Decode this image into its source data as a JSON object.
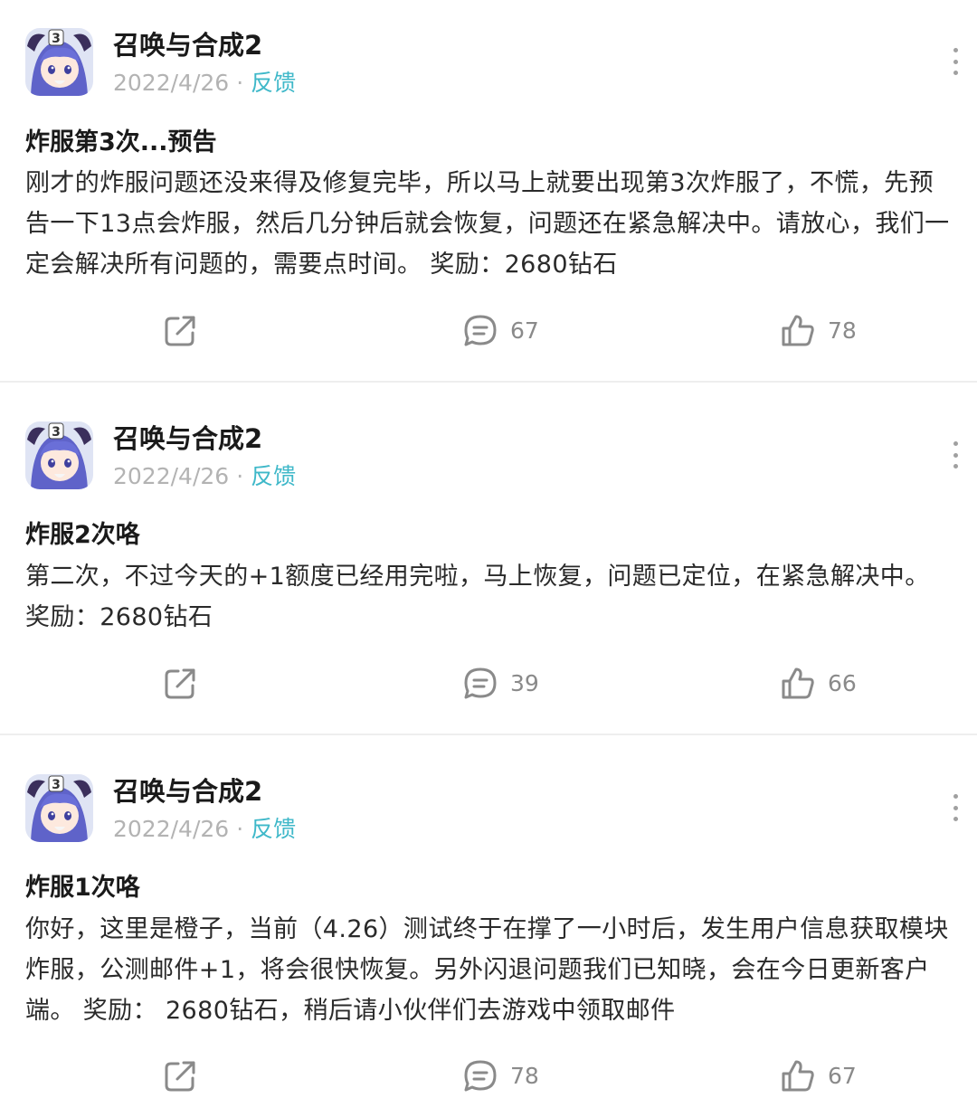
{
  "posts": [
    {
      "author": "召唤与合成2",
      "date": "2022/4/26",
      "separator": "·",
      "tag": "反馈",
      "title": "炸服第3次...预告",
      "body": "刚才的炸服问题还没来得及修复完毕，所以马上就要出现第3次炸服了，不慌，先预告一下13点会炸服，然后几分钟后就会恢复，问题还在紧急解决中。请放心，我们一定会解决所有问题的，需要点时间。 奖励：2680钻石",
      "comments": "67",
      "likes": "78"
    },
    {
      "author": "召唤与合成2",
      "date": "2022/4/26",
      "separator": "·",
      "tag": "反馈",
      "title": "炸服2次咯",
      "body": "第二次，不过今天的+1额度已经用完啦，马上恢复，问题已定位，在紧急解决中。 奖励：2680钻石",
      "comments": "39",
      "likes": "66"
    },
    {
      "author": "召唤与合成2",
      "date": "2022/4/26",
      "separator": "·",
      "tag": "反馈",
      "title": "炸服1次咯",
      "body": "你好，这里是橙子，当前（4.26）测试终于在撑了一小时后，发生用户信息获取模块炸服，公测邮件+1，将会很快恢复。另外闪退问题我们已知晓，会在今日更新客户端。 奖励： 2680钻石，稍后请小伙伴们去游戏中领取邮件",
      "comments": "78",
      "likes": "67"
    }
  ],
  "icons": {
    "share": "share-icon",
    "comment": "comment-icon",
    "like": "thumbs-up-icon",
    "more": "more-vertical-icon"
  },
  "colors": {
    "tag": "#3fb8c9",
    "meta": "#b3b3b3",
    "icon": "#8a8a8a",
    "divider": "#eeeeee"
  }
}
